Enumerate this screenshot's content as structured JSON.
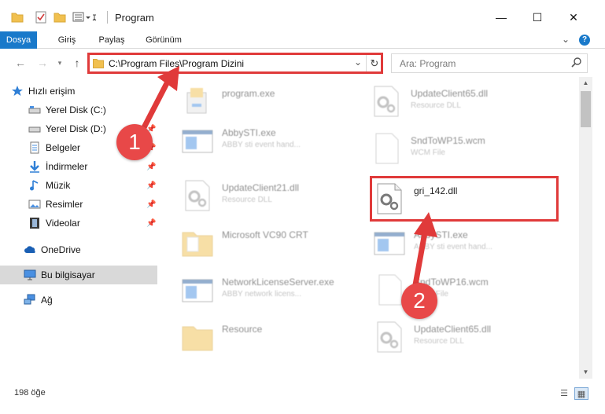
{
  "window": {
    "title": "Program",
    "minimize_icon": "—",
    "maximize_icon": "☐",
    "close_icon": "✕"
  },
  "ribbon": {
    "tabs": [
      "Dosya",
      "Giriş",
      "Paylaş",
      "Görünüm"
    ],
    "help_label": "?"
  },
  "address": {
    "path": "C:\\Program Files\\Program Dizini",
    "search_placeholder": "Ara: Program"
  },
  "sidebar": {
    "items": [
      {
        "label": "Hızlı erişim",
        "icon": "star-icon",
        "pinned": false
      },
      {
        "label": "Yerel Disk (C:)",
        "icon": "drive-icon",
        "pinned": false
      },
      {
        "label": "Yerel Disk (D:)",
        "icon": "drive-icon",
        "pinned": true
      },
      {
        "label": "Belgeler",
        "icon": "documents-icon",
        "pinned": true
      },
      {
        "label": "İndirmeler",
        "icon": "download-icon",
        "pinned": true
      },
      {
        "label": "Müzik",
        "icon": "music-icon",
        "pinned": true
      },
      {
        "label": "Resimler",
        "icon": "pictures-icon",
        "pinned": true
      },
      {
        "label": "Videolar",
        "icon": "video-icon",
        "pinned": true
      },
      {
        "label": "OneDrive",
        "icon": "cloud-icon",
        "pinned": false
      },
      {
        "label": "Bu bilgisayar",
        "icon": "computer-icon",
        "pinned": false,
        "selected": true
      },
      {
        "label": "Ağ",
        "icon": "network-icon",
        "pinned": false
      }
    ]
  },
  "files": {
    "left": [
      {
        "name": "program.exe",
        "desc": "",
        "icon": "installer-icon"
      },
      {
        "name": "AbbySTI.exe",
        "desc": "ABBY sti event hand...",
        "icon": "app-window-icon"
      },
      {
        "name": "UpdateClient21.dll",
        "desc": "Resource DLL",
        "icon": "dll-gear-icon"
      },
      {
        "name": "Microsoft VC90 CRT",
        "desc": "",
        "icon": "folder-icon"
      },
      {
        "name": "NetworkLicenseServer.exe",
        "desc": "ABBY network licens...",
        "icon": "app-window-icon"
      },
      {
        "name": "Resource",
        "desc": "",
        "icon": "folder-icon"
      }
    ],
    "right": [
      {
        "name": "UpdateClient65.dll",
        "desc": "Resource DLL",
        "icon": "dll-gear-icon"
      },
      {
        "name": "SndToWP15.wcm",
        "desc": "WCM File",
        "icon": "blank-file-icon"
      },
      {
        "name": "gri_142.dll",
        "desc": "",
        "icon": "dll-gear-icon",
        "highlight": true
      },
      {
        "name": "AbbySTI.exe",
        "desc": "ABBY sti event hand...",
        "icon": "app-window-icon"
      },
      {
        "name": "SndToWP16.wcm",
        "desc": "WCM File",
        "icon": "blank-file-icon"
      },
      {
        "name": "UpdateClient65.dll",
        "desc": "Resource DLL",
        "icon": "dll-gear-icon"
      }
    ]
  },
  "status": {
    "count_text": "198 öğe"
  },
  "annotations": {
    "step1": "1",
    "step2": "2",
    "color": "#e03a3a"
  },
  "colors": {
    "accent": "#1979ca",
    "selection": "#d9d9d9",
    "folder": "#f1c04f"
  }
}
